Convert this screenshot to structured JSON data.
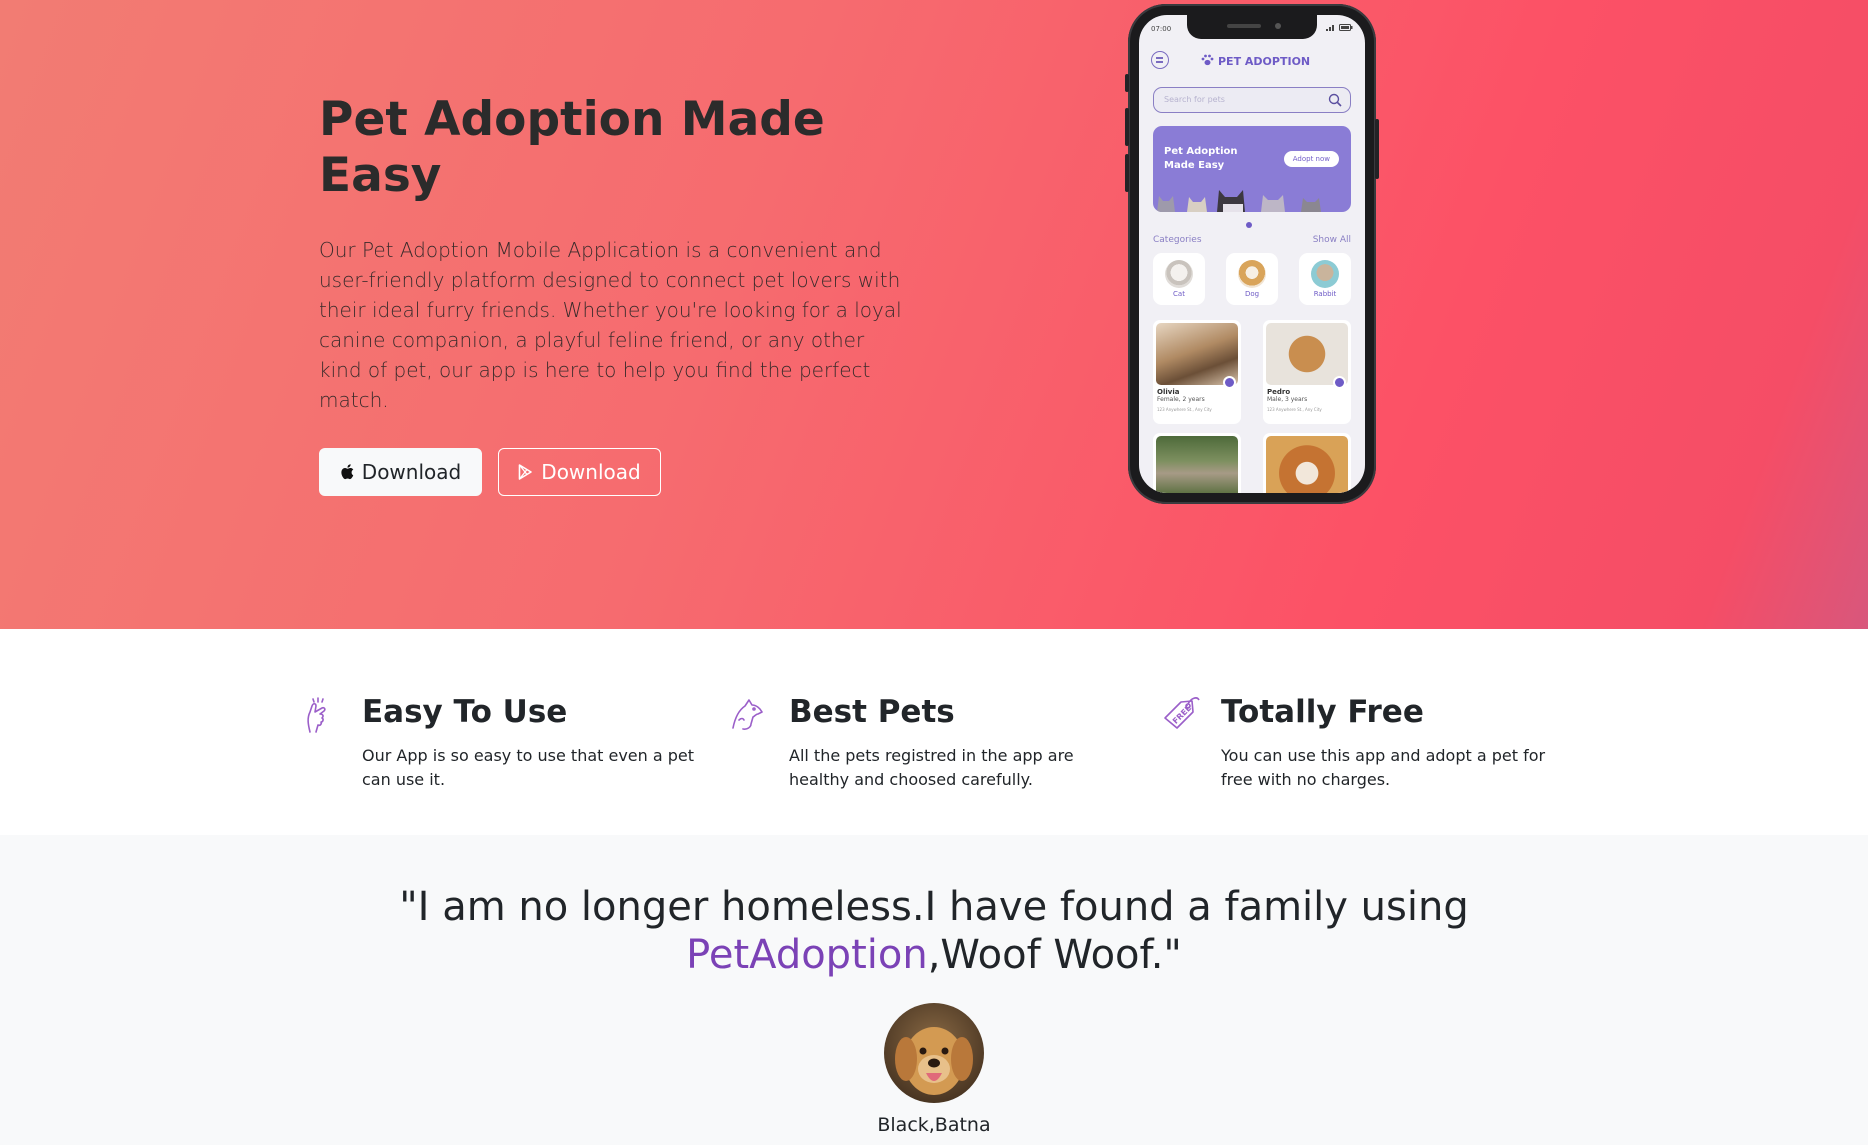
{
  "hero": {
    "title": "Pet Adoption Made Easy",
    "description": "Our Pet Adoption Mobile Application is a convenient and user-friendly platform designed to connect pet lovers with their ideal furry friends. Whether you're looking for a loyal canine companion, a playful feline friend, or any other kind of pet, our app is here to help you find the perfect match.",
    "download_apple_label": "Download",
    "download_play_label": "Download",
    "apple_icon": "apple-icon",
    "play_icon": "google-play-icon"
  },
  "phone": {
    "time": "07:00",
    "app_title": "PET ADOPTION",
    "search_placeholder": "Search for pets",
    "banner_title_line1": "Pet Adoption",
    "banner_title_line2": "Made Easy",
    "banner_button": "Adopt now",
    "categories_label": "Categories",
    "show_all_label": "Show All",
    "categories": [
      {
        "label": "Cat"
      },
      {
        "label": "Dog"
      },
      {
        "label": "Rabbit"
      }
    ],
    "pets": [
      {
        "name": "Olivia",
        "info": "Female, 2 years",
        "address": "123 Anywhere St., Any City"
      },
      {
        "name": "Pedro",
        "info": "Male, 3 years",
        "address": "123 Anywhere St., Any City"
      },
      {
        "name": "",
        "info": "",
        "address": ""
      },
      {
        "name": "",
        "info": "",
        "address": ""
      }
    ]
  },
  "features": [
    {
      "icon": "hand-gesture-icon",
      "title": "Easy To Use",
      "description": "Our App is so easy to use that even a pet can use it."
    },
    {
      "icon": "pet-head-icon",
      "title": "Best Pets",
      "description": "All the pets registred in the app are healthy and choosed carefully."
    },
    {
      "icon": "free-tag-icon",
      "title": "Totally Free",
      "description": "You can use this app and adopt a pet for free with no charges."
    }
  ],
  "testimonial": {
    "quote_part1": "\"I am no longer homeless.I have found a family using",
    "quote_accent": "PetAdoption",
    "quote_part2": ",Woof Woof.\"",
    "author": "Black,Batna",
    "avatar_icon": "golden-retriever-avatar"
  },
  "colors": {
    "hero_gradient_start": "#f27c73",
    "hero_gradient_end": "#fc5166",
    "accent_purple": "#7b42b6",
    "feature_icon": "#9b5fc9"
  }
}
